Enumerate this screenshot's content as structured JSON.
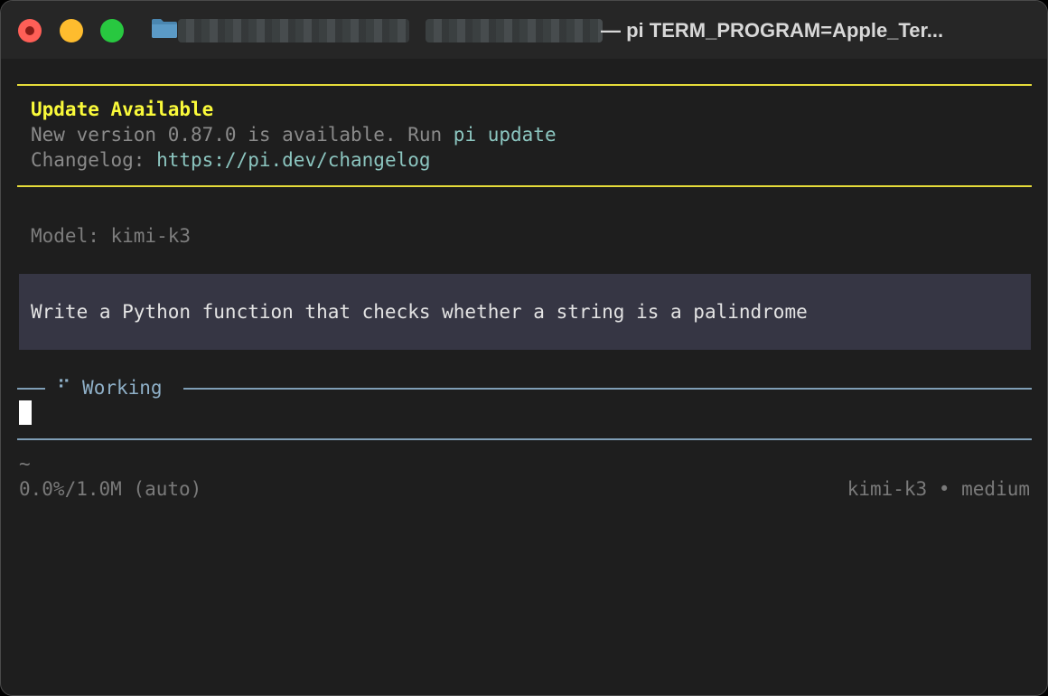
{
  "window": {
    "title": "— pi TERM_PROGRAM=Apple_Ter..."
  },
  "colors": {
    "update_title": "#fafa3a",
    "accent": "#8cc6c0",
    "rule_yellow": "#e6dc3a",
    "rule_blue": "#7f9eb6",
    "prompt_background": "#363644"
  },
  "update_notice": {
    "title": "Update Available",
    "line1_prefix": "New version 0.87.0 is available. Run ",
    "line1_command": "pi update",
    "line2_prefix": "Changelog: ",
    "line2_link": "https://pi.dev/changelog"
  },
  "session": {
    "model_line": "Model: kimi-k3",
    "user_prompt": "Write a Python function that checks whether a string is a palindrome",
    "working_spinner": "⠋",
    "working_label": "Working"
  },
  "status_bar": {
    "cwd": "~",
    "context_usage": "0.0%/1.0M (auto)",
    "model_info": "kimi-k3 • medium"
  },
  "icons": {
    "folder": "folder-icon"
  }
}
